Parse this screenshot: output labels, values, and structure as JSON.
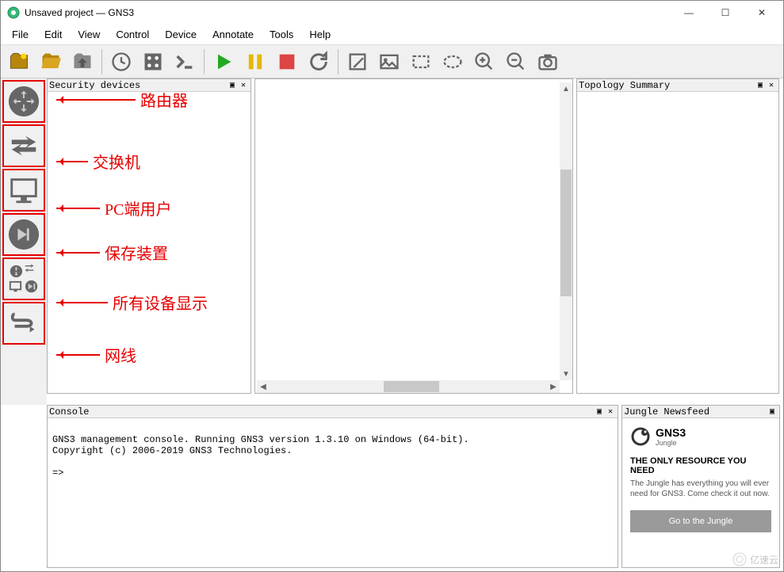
{
  "window": {
    "title": "Unsaved project — GNS3",
    "min": "—",
    "max": "☐",
    "close": "✕"
  },
  "menu": {
    "file": "File",
    "edit": "Edit",
    "view": "View",
    "control": "Control",
    "device": "Device",
    "annotate": "Annotate",
    "tools": "Tools",
    "help": "Help"
  },
  "panels": {
    "security": {
      "title": "Security devices"
    },
    "topology": {
      "title": "Topology Summary"
    },
    "console": {
      "title": "Console"
    },
    "newsfeed": {
      "title": "Jungle Newsfeed"
    }
  },
  "console": {
    "line1": "GNS3 management console. Running GNS3 version 1.3.10 on Windows (64-bit).",
    "line2": "Copyright (c) 2006-2019 GNS3 Technologies.",
    "prompt": "=>"
  },
  "newsfeed": {
    "logo_main": "GNS3",
    "logo_sub": "Jungle",
    "heading": "THE ONLY RESOURCE YOU NEED",
    "text": "The Jungle has everything you will ever need for GNS3. Come check it out now.",
    "button": "Go to the Jungle"
  },
  "annotations": {
    "router": "路由器",
    "switch": "交换机",
    "pc": "PC端用户",
    "save": "保存装置",
    "all": "所有设备显示",
    "cable": "网线"
  },
  "watermark": "亿速云"
}
